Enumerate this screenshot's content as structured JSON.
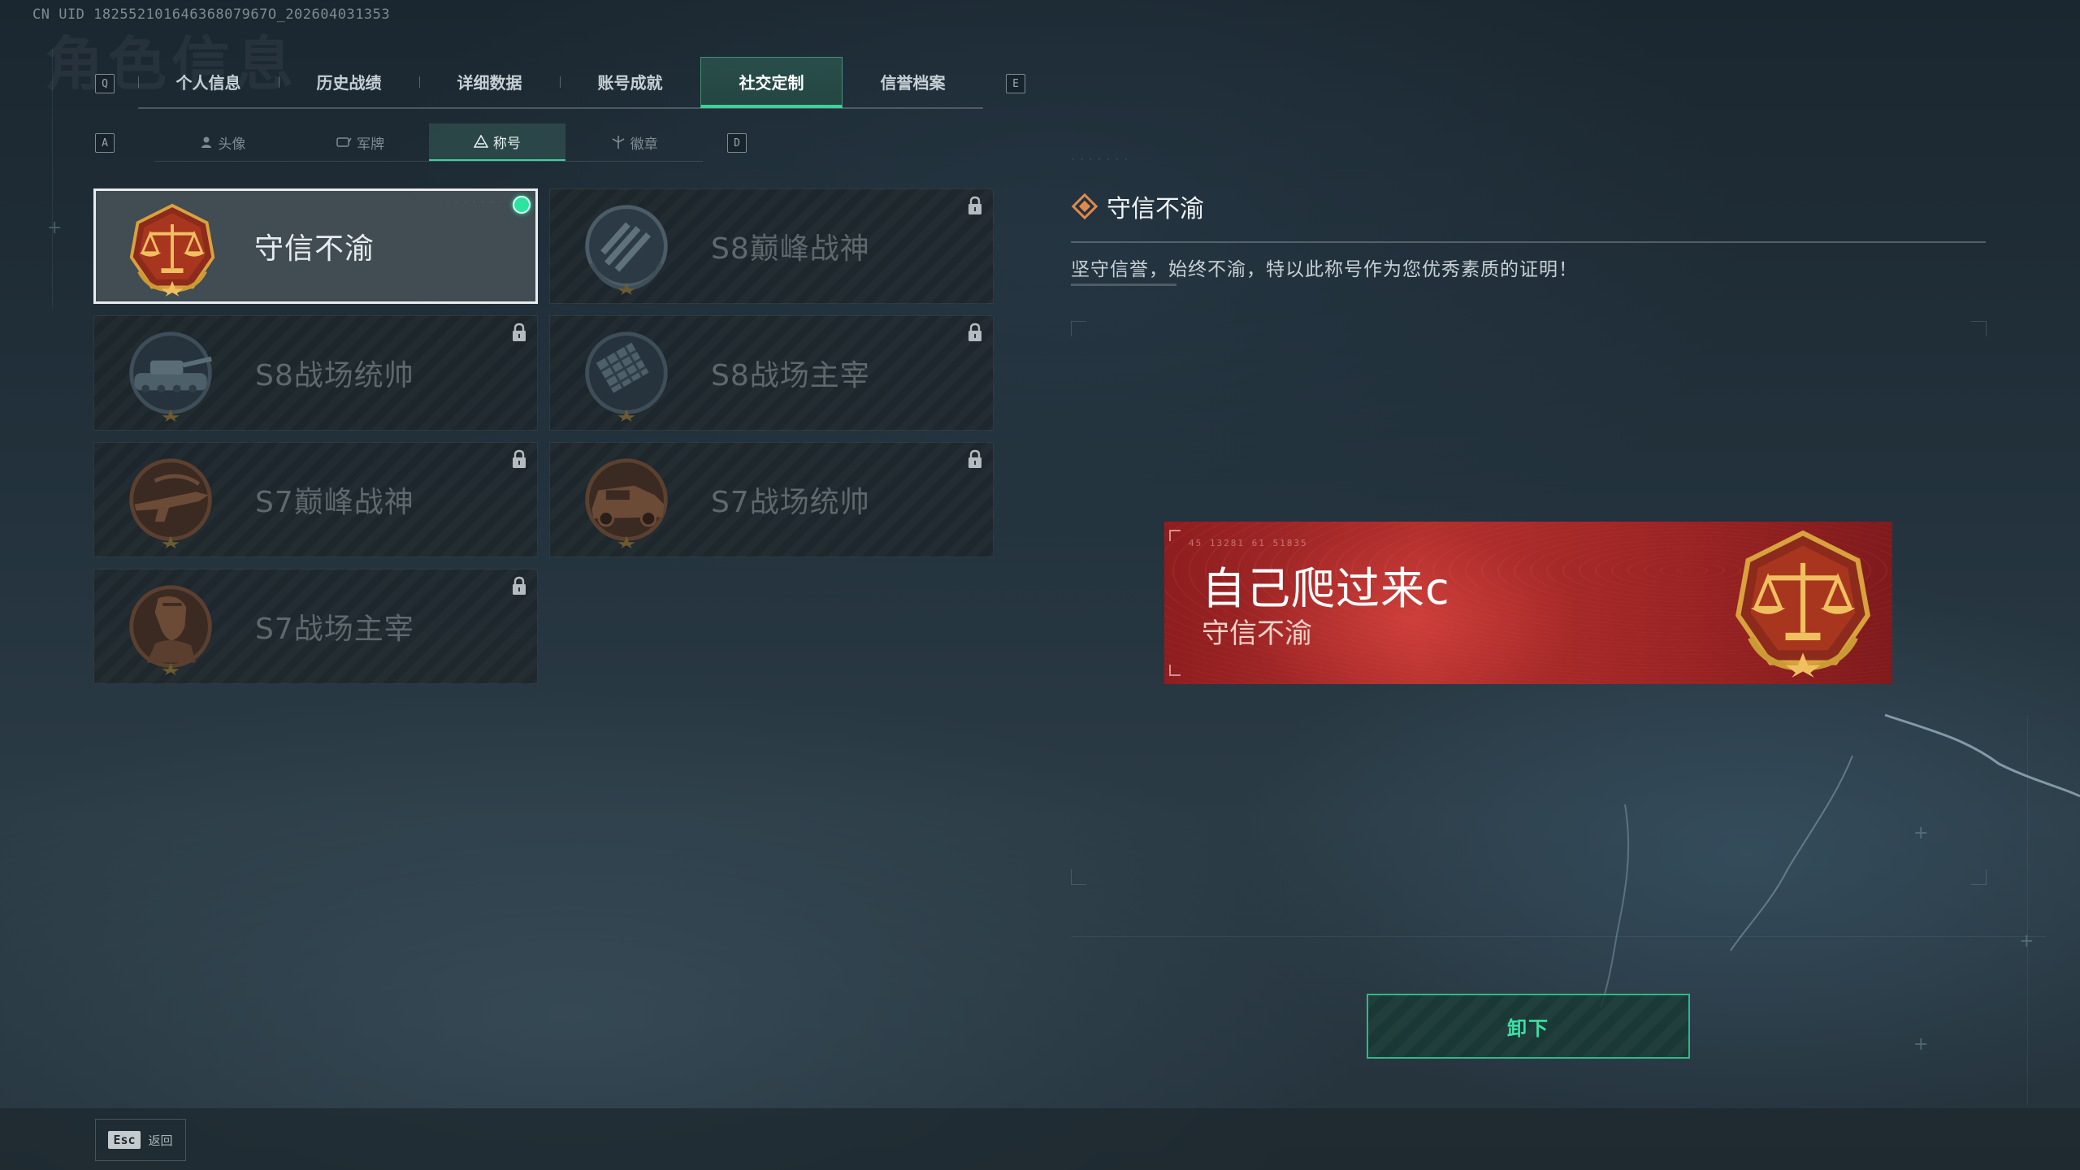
{
  "header": {
    "uid": "CN UID 18255210164636807967O_202604031353",
    "bg_title": "角色信息"
  },
  "main_tabs": {
    "prev_key": "Q",
    "next_key": "E",
    "items": [
      {
        "label": "个人信息",
        "active": false
      },
      {
        "label": "历史战绩",
        "active": false
      },
      {
        "label": "详细数据",
        "active": false
      },
      {
        "label": "账号成就",
        "active": false
      },
      {
        "label": "社交定制",
        "active": true
      },
      {
        "label": "信誉档案",
        "active": false
      }
    ]
  },
  "sub_tabs": {
    "prev_key": "A",
    "next_key": "D",
    "items": [
      {
        "label": "头像",
        "icon": "person-icon",
        "active": false
      },
      {
        "label": "军牌",
        "icon": "dogtag-icon",
        "active": false
      },
      {
        "label": "称号",
        "icon": "title-icon",
        "active": true
      },
      {
        "label": "徽章",
        "icon": "badge-icon",
        "active": false
      }
    ]
  },
  "titles": [
    {
      "name": "守信不渝",
      "emblem": "scales-emblem",
      "locked": false,
      "equipped": true
    },
    {
      "name": "S8巅峰战神",
      "emblem": "stripes-emblem",
      "locked": true,
      "equipped": false
    },
    {
      "name": "S8战场统帅",
      "emblem": "tank-emblem",
      "locked": true,
      "equipped": false
    },
    {
      "name": "S8战场主宰",
      "emblem": "launcher-emblem",
      "locked": true,
      "equipped": false
    },
    {
      "name": "S7巅峰战神",
      "emblem": "rifle-emblem",
      "locked": true,
      "equipped": false
    },
    {
      "name": "S7战场统帅",
      "emblem": "vehicle-emblem",
      "locked": true,
      "equipped": false
    },
    {
      "name": "S7战场主宰",
      "emblem": "soldier-emblem",
      "locked": true,
      "equipped": false
    }
  ],
  "detail": {
    "title": "守信不渝",
    "description": "坚守信誉，始终不渝，特以此称号作为您优秀素质的证明！"
  },
  "banner": {
    "code": "45 13281 61 51835",
    "player_name": "自己爬过来c",
    "title": "守信不渝"
  },
  "actions": {
    "unequip_label": "卸下",
    "esc_key": "Esc",
    "back_label": "返回"
  },
  "colors": {
    "accent": "#3fd19a",
    "banner_red": "#a82a2a",
    "emblem_gold": "#d9a23c"
  }
}
